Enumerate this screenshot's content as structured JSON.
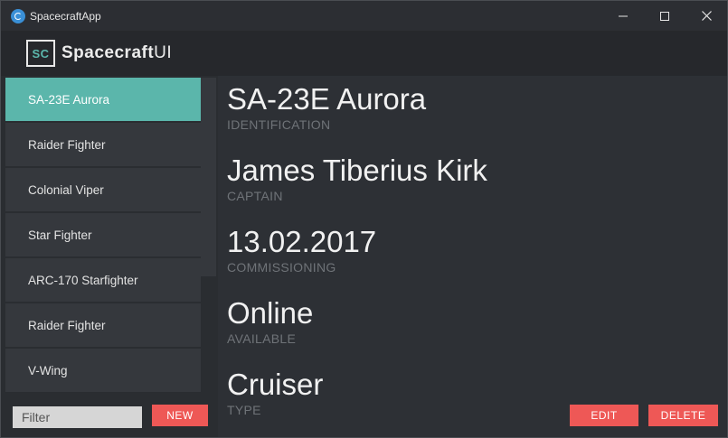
{
  "window": {
    "title": "SpacecraftApp"
  },
  "header": {
    "logo_text": "SC",
    "brand_bold": "Spacecraft",
    "brand_light": "UI"
  },
  "list": {
    "items": [
      {
        "label": "SA-23E Aurora",
        "selected": true
      },
      {
        "label": "Raider Fighter",
        "selected": false
      },
      {
        "label": "Colonial Viper",
        "selected": false
      },
      {
        "label": "Star Fighter",
        "selected": false
      },
      {
        "label": "ARC-170 Starfighter",
        "selected": false
      },
      {
        "label": "Raider Fighter",
        "selected": false
      },
      {
        "label": "V-Wing",
        "selected": false
      }
    ],
    "filter_placeholder": "Filter",
    "new_label": "NEW"
  },
  "detail": {
    "fields": [
      {
        "value": "SA-23E Aurora",
        "label": "IDENTIFICATION"
      },
      {
        "value": "James Tiberius Kirk",
        "label": "CAPTAIN"
      },
      {
        "value": "13.02.2017",
        "label": "COMMISSIONING"
      },
      {
        "value": "Online",
        "label": "AVAILABLE"
      },
      {
        "value": "Cruiser",
        "label": "TYPE"
      }
    ],
    "edit_label": "EDIT",
    "delete_label": "DELETE"
  },
  "colors": {
    "accent": "#5bb6ab",
    "danger": "#ee5856",
    "background": "#2d3035"
  }
}
